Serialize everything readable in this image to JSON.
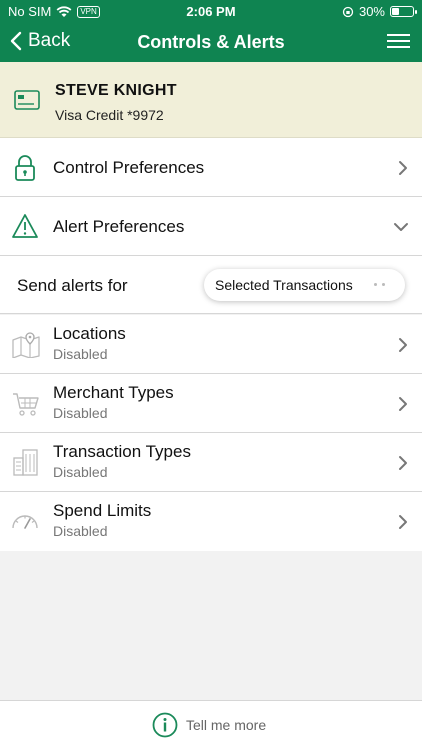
{
  "status_bar": {
    "carrier": "No SIM",
    "vpn": "VPN",
    "time": "2:06 PM",
    "battery": "30%"
  },
  "nav": {
    "back_label": "Back",
    "title": "Controls & Alerts"
  },
  "card": {
    "holder_name": "STEVE KNIGHT",
    "description": "Visa Credit *9972"
  },
  "sections": {
    "control_preferences": "Control Preferences",
    "alert_preferences": "Alert Preferences"
  },
  "alerts": {
    "send_alerts_label": "Send alerts for",
    "selected_option": "Selected Transactions",
    "items": [
      {
        "label": "Locations",
        "status": "Disabled",
        "icon": "map-icon"
      },
      {
        "label": "Merchant Types",
        "status": "Disabled",
        "icon": "cart-icon"
      },
      {
        "label": "Transaction Types",
        "status": "Disabled",
        "icon": "buildings-icon"
      },
      {
        "label": "Spend Limits",
        "status": "Disabled",
        "icon": "gauge-icon"
      }
    ]
  },
  "footer": {
    "tell_me_more": "Tell me more"
  },
  "colors": {
    "brand_green": "#0f8451",
    "card_bg": "#f1efd9",
    "icon_green": "#1b8a5a"
  }
}
